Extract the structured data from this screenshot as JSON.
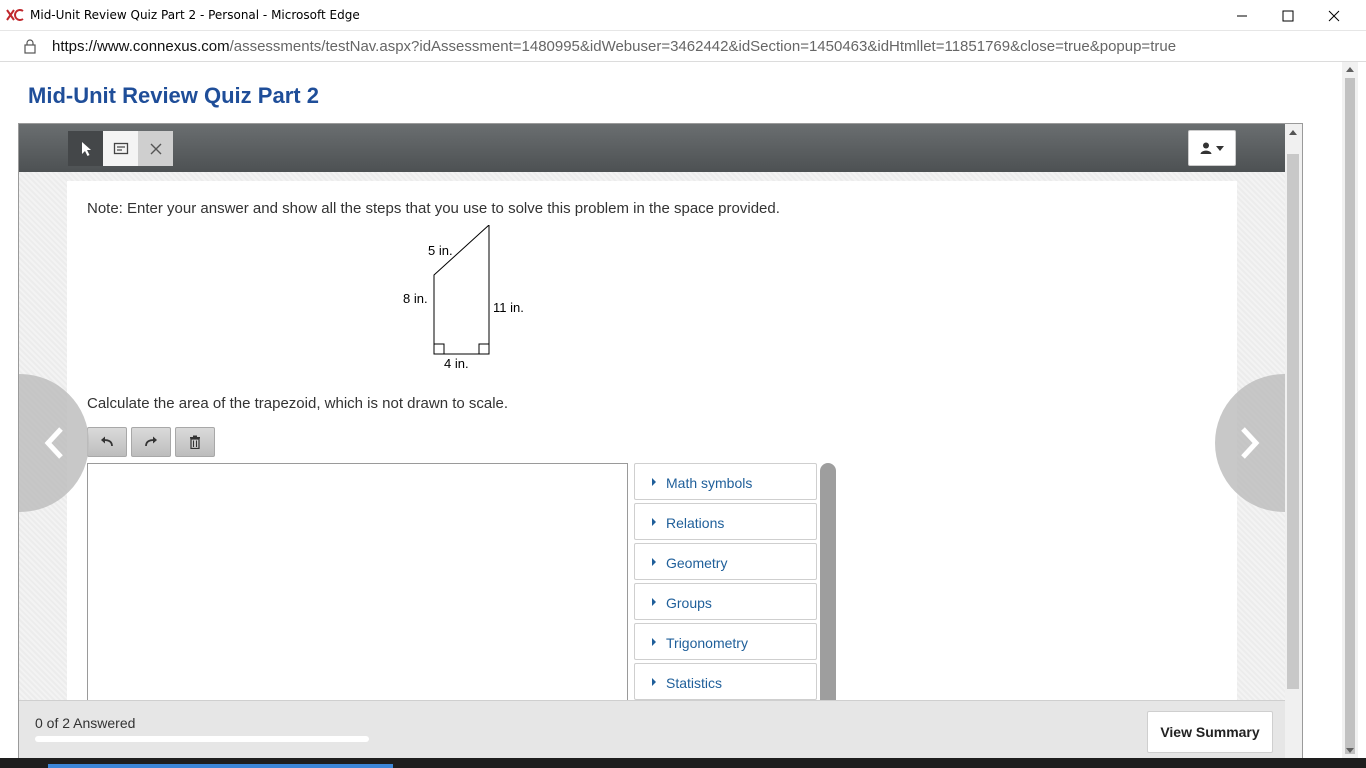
{
  "window": {
    "title": "Mid-Unit Review Quiz Part 2 - Personal - Microsoft Edge",
    "url_host": "https://www.connexus.com",
    "url_path": "/assessments/testNav.aspx?idAssessment=1480995&idWebuser=3462442&idSection=1450463&idHtmllet=11851769&close=true&popup=true"
  },
  "page": {
    "title": "Mid-Unit Review Quiz Part 2"
  },
  "toolbar": {
    "tools": [
      {
        "icon": "pointer-icon"
      },
      {
        "icon": "note-icon"
      },
      {
        "icon": "close-icon"
      }
    ],
    "user_icon": "user-icon"
  },
  "question": {
    "note": "Note: Enter your answer and show all the steps that you use to solve this problem in the space provided.",
    "prompt": "Calculate the area of the trapezoid, which is not drawn to scale.",
    "figure": {
      "label_slant": "5 in.",
      "label_left": "8 in.",
      "label_right": "11 in.",
      "label_bottom": "4 in."
    }
  },
  "editor": {
    "undo_icon": "undo-icon",
    "redo_icon": "redo-icon",
    "clear_icon": "trash-icon",
    "answer_value": ""
  },
  "palette": {
    "items": [
      {
        "label": "Math symbols"
      },
      {
        "label": "Relations"
      },
      {
        "label": "Geometry"
      },
      {
        "label": "Groups"
      },
      {
        "label": "Trigonometry"
      },
      {
        "label": "Statistics"
      }
    ]
  },
  "footer": {
    "answered": "0 of 2 Answered",
    "progress_fraction": 0,
    "summary_button": "View Summary"
  },
  "colors": {
    "title_blue": "#1f4e99",
    "link_blue": "#1f5f9a",
    "toolbar_dark": "#4d5153"
  }
}
